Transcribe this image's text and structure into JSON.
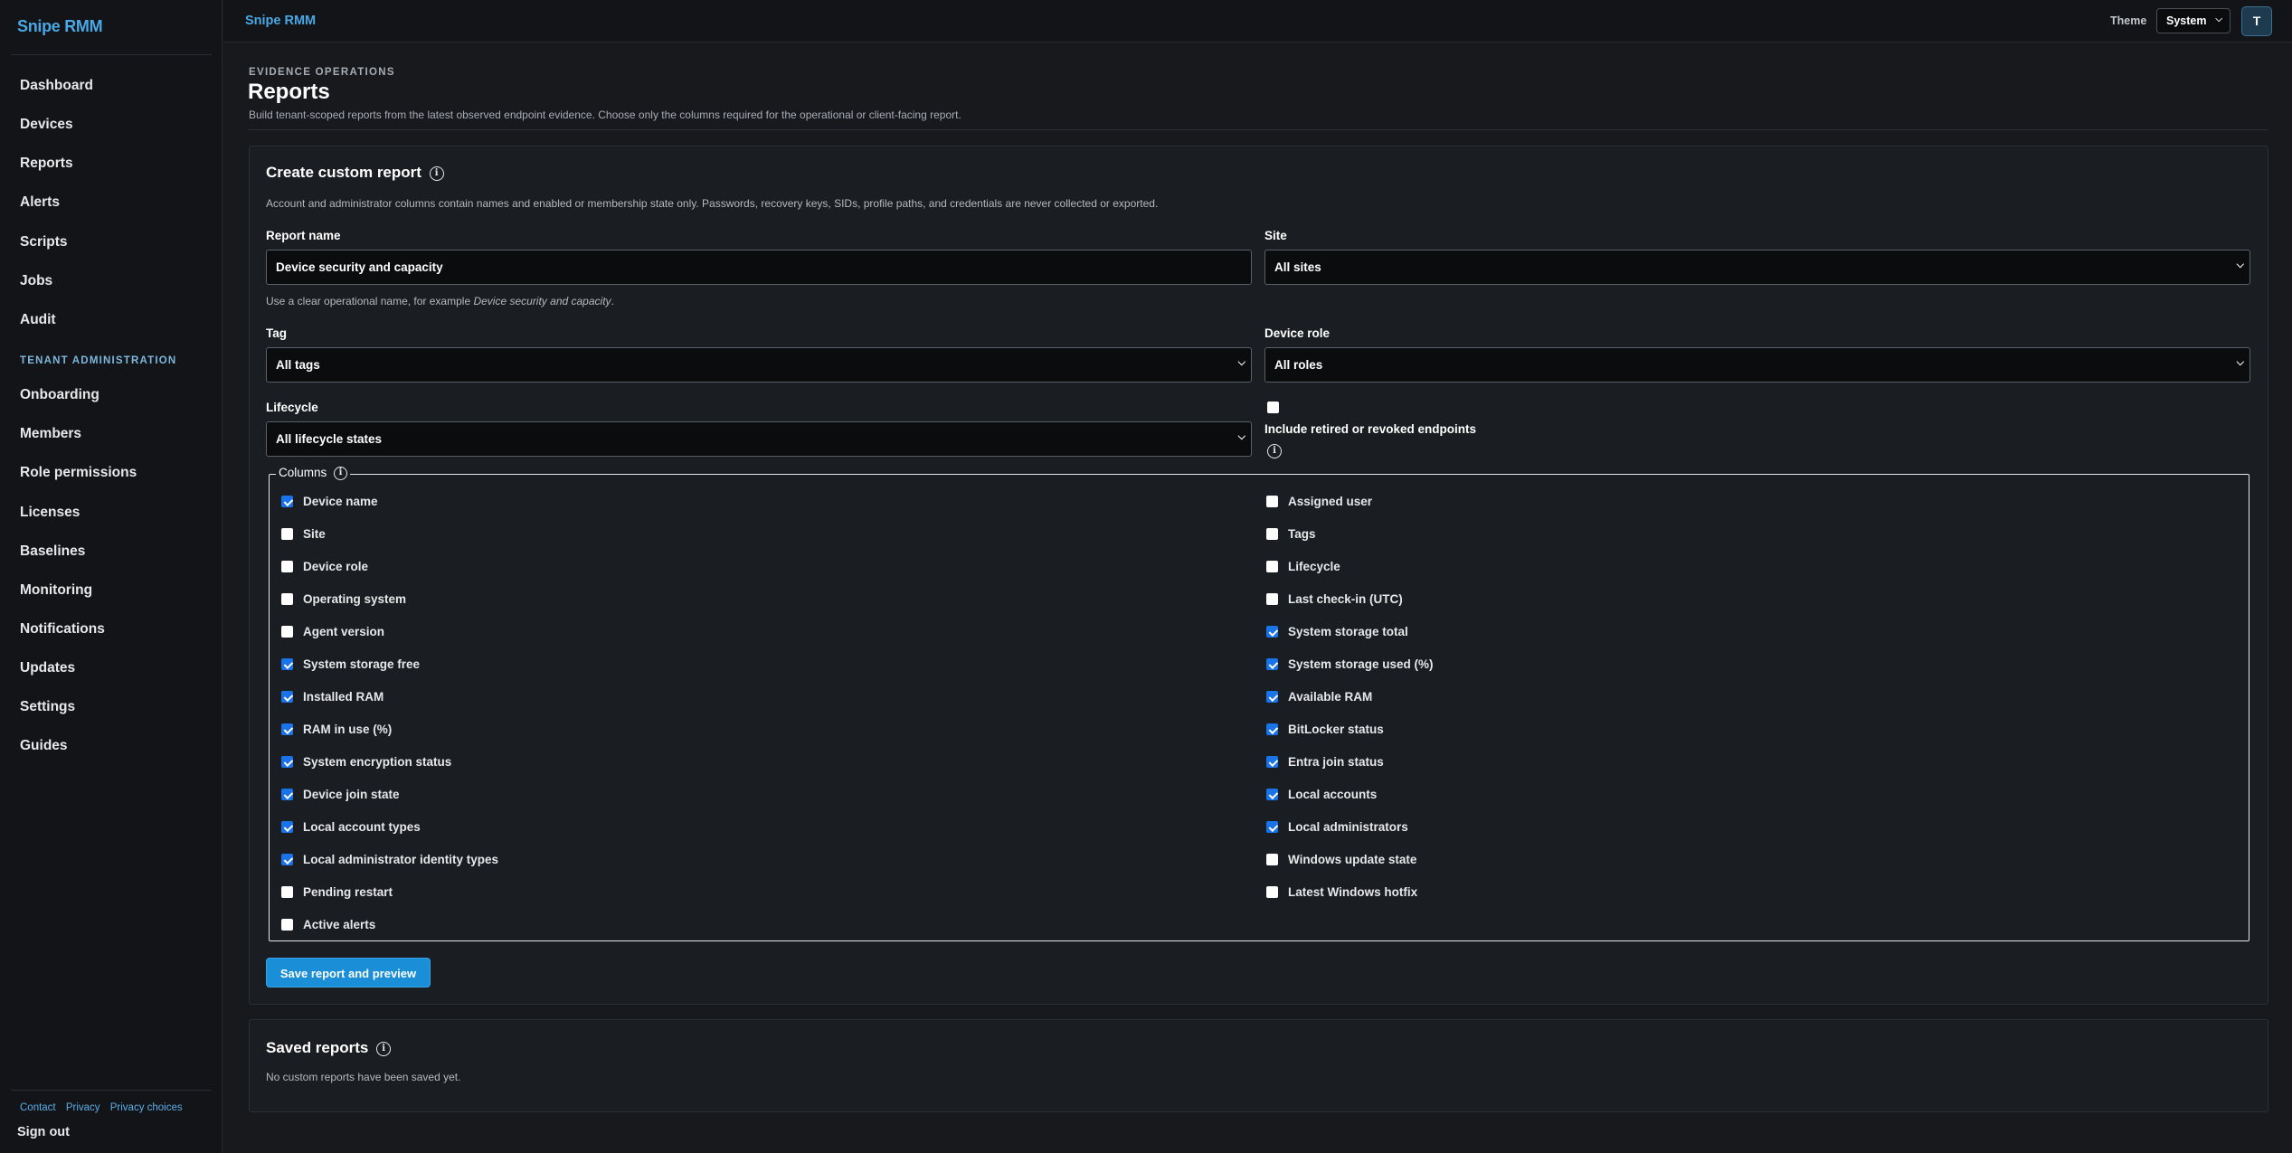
{
  "sidebar": {
    "brand": "Snipe RMM",
    "items": [
      "Dashboard",
      "Devices",
      "Reports",
      "Alerts",
      "Scripts",
      "Jobs",
      "Audit"
    ],
    "admin_heading": "TENANT ADMINISTRATION",
    "admin_items": [
      "Onboarding",
      "Members",
      "Role permissions",
      "Licenses",
      "Baselines",
      "Monitoring",
      "Notifications",
      "Updates",
      "Settings",
      "Guides"
    ],
    "footer_links": [
      "Contact",
      "Privacy",
      "Privacy choices"
    ],
    "sign_out": "Sign out"
  },
  "header": {
    "brand": "Snipe RMM",
    "theme_label": "Theme",
    "theme_value": "System",
    "avatar": "T"
  },
  "page": {
    "eyebrow": "EVIDENCE OPERATIONS",
    "title": "Reports",
    "description": "Build tenant-scoped reports from the latest observed endpoint evidence. Choose only the columns required for the operational or client-facing report."
  },
  "form": {
    "title": "Create custom report",
    "notice": "Account and administrator columns contain names and enabled or membership state only. Passwords, recovery keys, SIDs, profile paths, and credentials are never collected or exported.",
    "report_name_label": "Report name",
    "report_name_value": "Device security and capacity",
    "report_name_help_prefix": "Use a clear operational name, for example ",
    "report_name_help_example": "Device security and capacity",
    "report_name_help_suffix": ".",
    "site_label": "Site",
    "site_value": "All sites",
    "tag_label": "Tag",
    "tag_value": "All tags",
    "role_label": "Device role",
    "role_value": "All roles",
    "lifecycle_label": "Lifecycle",
    "lifecycle_value": "All lifecycle states",
    "include_retired_label": "Include retired or revoked endpoints",
    "include_retired_checked": false,
    "columns_legend": "Columns",
    "columns_left": [
      {
        "label": "Device name",
        "checked": true
      },
      {
        "label": "Site",
        "checked": false
      },
      {
        "label": "Device role",
        "checked": false
      },
      {
        "label": "Operating system",
        "checked": false
      },
      {
        "label": "Agent version",
        "checked": false
      },
      {
        "label": "System storage free",
        "checked": true
      },
      {
        "label": "Installed RAM",
        "checked": true
      },
      {
        "label": "RAM in use (%)",
        "checked": true
      },
      {
        "label": "System encryption status",
        "checked": true
      },
      {
        "label": "Device join state",
        "checked": true
      },
      {
        "label": "Local account types",
        "checked": true
      },
      {
        "label": "Local administrator identity types",
        "checked": true
      },
      {
        "label": "Pending restart",
        "checked": false
      },
      {
        "label": "Active alerts",
        "checked": false
      }
    ],
    "columns_right": [
      {
        "label": "Assigned user",
        "checked": false
      },
      {
        "label": "Tags",
        "checked": false
      },
      {
        "label": "Lifecycle",
        "checked": false
      },
      {
        "label": "Last check-in (UTC)",
        "checked": false
      },
      {
        "label": "System storage total",
        "checked": true
      },
      {
        "label": "System storage used (%)",
        "checked": true
      },
      {
        "label": "Available RAM",
        "checked": true
      },
      {
        "label": "BitLocker status",
        "checked": true
      },
      {
        "label": "Entra join status",
        "checked": true
      },
      {
        "label": "Local accounts",
        "checked": true
      },
      {
        "label": "Local administrators",
        "checked": true
      },
      {
        "label": "Windows update state",
        "checked": false
      },
      {
        "label": "Latest Windows hotfix",
        "checked": false
      }
    ],
    "submit_label": "Save report and preview"
  },
  "saved": {
    "title": "Saved reports",
    "empty": "No custom reports have been saved yet."
  },
  "colors": {
    "accent": "#1a8fd8",
    "brand": "#4aa8e6",
    "checkbox": "#1a73e8"
  }
}
